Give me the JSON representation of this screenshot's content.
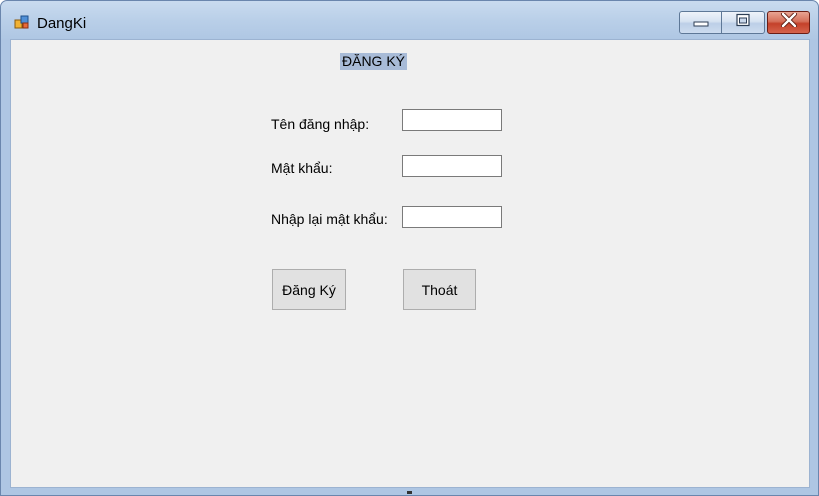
{
  "window": {
    "title": "DangKi"
  },
  "form": {
    "heading": "ĐĂNG KÝ",
    "username_label": "Tên đăng nhập:",
    "username_value": "",
    "password_label": "Mật khẩu:",
    "password_value": "",
    "confirm_label": "Nhập lại mật khẩu:",
    "confirm_value": "",
    "register_button": "Đăng Ký",
    "exit_button": "Thoát"
  },
  "icons": {
    "app": "app-icon",
    "minimize": "minimize-icon",
    "maximize": "maximize-icon",
    "close": "close-icon"
  },
  "colors": {
    "heading_highlight": "#a8bbd7",
    "client_background": "#f0f0f0",
    "close_button": "#c4412a"
  }
}
